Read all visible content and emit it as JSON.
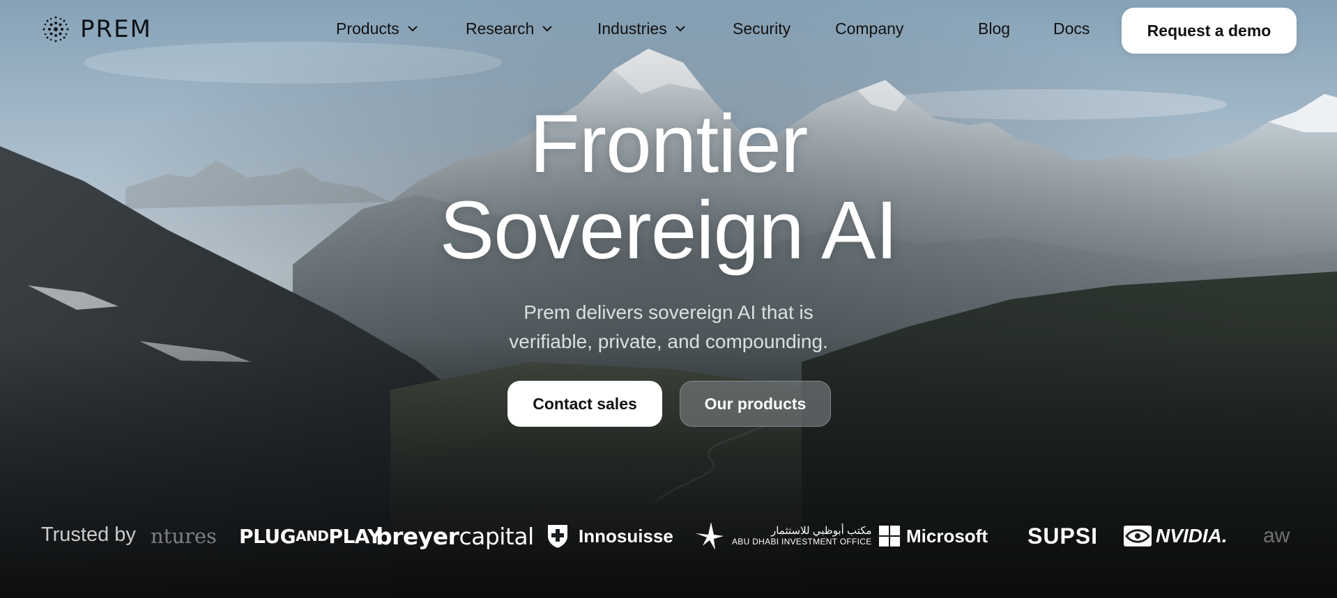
{
  "brand": {
    "name": "PREM"
  },
  "nav": {
    "items": [
      {
        "label": "Products",
        "has_dropdown": true
      },
      {
        "label": "Research",
        "has_dropdown": true
      },
      {
        "label": "Industries",
        "has_dropdown": true
      },
      {
        "label": "Security",
        "has_dropdown": false
      },
      {
        "label": "Company",
        "has_dropdown": false
      },
      {
        "label": "Blog",
        "has_dropdown": false
      },
      {
        "label": "Docs",
        "has_dropdown": false
      }
    ],
    "cta_label": "Request a demo"
  },
  "hero": {
    "title_line1": "Frontier",
    "title_line2": "Sovereign AI",
    "subtitle_line1": "Prem delivers sovereign AI that is",
    "subtitle_line2": "verifiable, private, and compounding.",
    "primary_cta": "Contact sales",
    "secondary_cta": "Our products"
  },
  "trust": {
    "label": "Trusted by",
    "logos": [
      {
        "name": "ventures-partial",
        "text": "ntures"
      },
      {
        "name": "plug-and-play",
        "text_a": "PLUG",
        "text_b": "AND",
        "text_c": "PLAY"
      },
      {
        "name": "breyer-capital",
        "text_a": "breyer",
        "text_b": "capital"
      },
      {
        "name": "innosuisse",
        "text": "Innosuisse"
      },
      {
        "name": "abu-dhabi-investment-office",
        "text_ar": "مكتب أبوظبي للاستثمار",
        "text_en": "ABU DHABI INVESTMENT OFFICE"
      },
      {
        "name": "microsoft",
        "text": "Microsoft"
      },
      {
        "name": "supsi",
        "text": "SUPSI"
      },
      {
        "name": "nvidia",
        "text": "NVIDIA."
      },
      {
        "name": "aws-partial",
        "text": "aw"
      }
    ]
  },
  "colors": {
    "sky_top": "#8ea9bd",
    "sky_bottom": "#c6d2da",
    "mountain_dark": "#23282c",
    "button_white": "#ffffff",
    "button_glass": "#6e7376"
  }
}
